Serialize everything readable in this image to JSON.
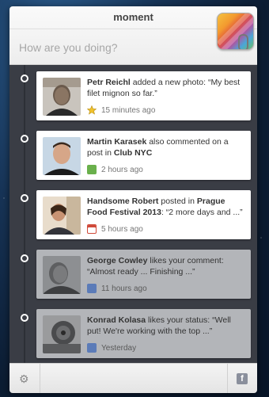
{
  "app": {
    "title": "moment"
  },
  "composer": {
    "placeholder": "How are you doing?"
  },
  "feed": [
    {
      "name": "Petr Reichl",
      "line": "added a new photo: “My best filet mignon so far.”",
      "time": "15 minutes ago",
      "icon": "star-icon",
      "read": false
    },
    {
      "name": "Martin Karasek",
      "line_pre": "also commented on a post in",
      "bold_tail": "Club NYC",
      "time": "2 hours ago",
      "icon": "comment-icon",
      "read": false
    },
    {
      "name": "Handsome Robert",
      "line_pre": "posted in",
      "bold_tail": "Prague Food Festival 2013",
      "line_post": ": “2 more days and ...”",
      "time": "5 hours ago",
      "icon": "calendar-icon",
      "read": false
    },
    {
      "name": "George Cowley",
      "line": "likes your comment: “Almost ready ... Finishing ...”",
      "time": "11 hours ago",
      "icon": "like-icon",
      "read": true
    },
    {
      "name": "Konrad Kolasa",
      "line": "likes your status: “Well put! We're working with the top ...”",
      "time": "Yesterday",
      "icon": "like-icon",
      "read": true
    }
  ],
  "footer": {
    "settings_icon": "gear-icon",
    "facebook_label": "f"
  }
}
